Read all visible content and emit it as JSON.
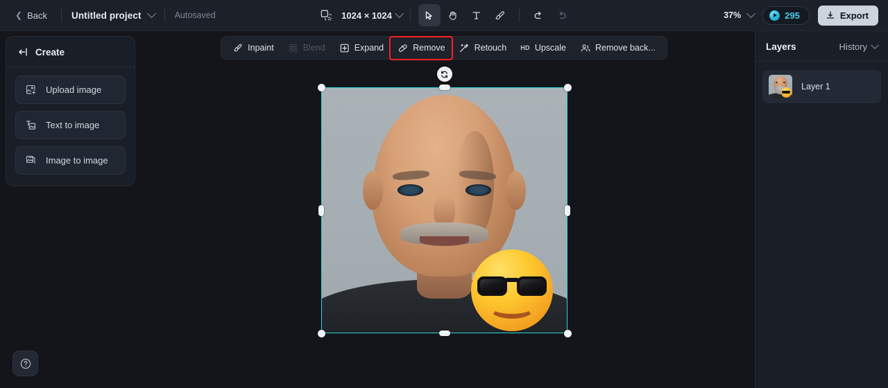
{
  "topbar": {
    "back_label": "Back",
    "project_name": "Untitled project",
    "autosaved_label": "Autosaved",
    "canvas_size": "1024 × 1024",
    "zoom_level": "37%",
    "credits": "295",
    "export_label": "Export",
    "icons": {
      "back_chevron": "chevron-left-icon",
      "project_caret": "chevron-down-icon",
      "canvas_size_icon": "canvas-resize-icon",
      "canvas_caret": "chevron-down-icon",
      "select_tool": "cursor-select-icon",
      "hand_tool": "hand-pan-icon",
      "text_tool": "text-tool-icon",
      "brush_tool": "brush-tool-icon",
      "undo": "undo-icon",
      "redo": "redo-icon",
      "zoom_caret": "chevron-down-icon",
      "credits_coin": "credit-coin-icon",
      "export": "download-icon"
    }
  },
  "sidebar": {
    "header": "Create",
    "header_icon": "collapse-panel-icon",
    "items": [
      {
        "label": "Upload image",
        "icon": "upload-image-icon"
      },
      {
        "label": "Text to image",
        "icon": "text-to-image-icon"
      },
      {
        "label": "Image to image",
        "icon": "image-to-image-icon"
      }
    ]
  },
  "edit_toolbar": {
    "items": [
      {
        "label": "Inpaint",
        "icon": "inpaint-brush-icon",
        "disabled": false
      },
      {
        "label": "Blend",
        "icon": "blend-icon",
        "disabled": true
      },
      {
        "label": "Expand",
        "icon": "expand-icon",
        "disabled": false
      },
      {
        "label": "Remove",
        "icon": "remove-eraser-icon",
        "disabled": false
      },
      {
        "label": "Retouch",
        "icon": "retouch-wand-icon",
        "disabled": false
      },
      {
        "label": "Upscale",
        "icon": "hd-upscale-icon",
        "badge": "HD",
        "disabled": false
      },
      {
        "label": "Remove back...",
        "icon": "remove-background-icon",
        "disabled": false
      }
    ],
    "highlighted_item": "Remove",
    "highlight_color": "#fb2020"
  },
  "canvas": {
    "selection_color": "#2fd9d2",
    "rotate_icon": "rotate-icon",
    "sticker": "sunglasses-emoji",
    "photo_alt": "bald-bearded-man-portrait"
  },
  "right_panel": {
    "title": "Layers",
    "history_label": "History",
    "history_icon": "chevron-down-icon",
    "layers": [
      {
        "name": "Layer 1",
        "thumb": "layer-thumbnail"
      }
    ]
  },
  "help": {
    "icon": "help-question-icon"
  }
}
